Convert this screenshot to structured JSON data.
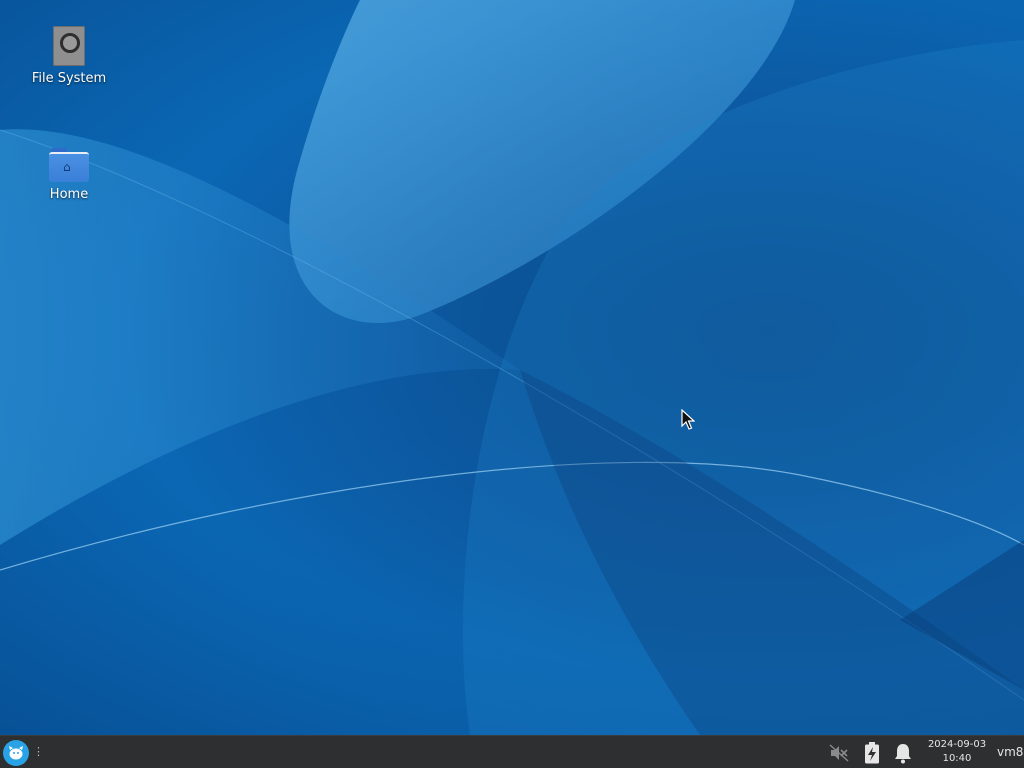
{
  "desktop": {
    "icons": [
      {
        "label": "File System",
        "icon": "drive-icon"
      },
      {
        "label": "Home",
        "icon": "home-folder-icon"
      }
    ]
  },
  "taskbar": {
    "menu_icon": "xfce-mouse-icon",
    "tray": {
      "volume_icon": "volume-muted-icon",
      "power_icon": "power-manager-icon",
      "notification_icon": "bell-icon"
    },
    "clock": {
      "date": "2024-09-03",
      "time": "10:40"
    },
    "hostname": "vm8"
  },
  "colors": {
    "desktop_background": "#0b67b4",
    "taskbar": "#2d2f31",
    "menu_button": "#2aa3e6"
  }
}
